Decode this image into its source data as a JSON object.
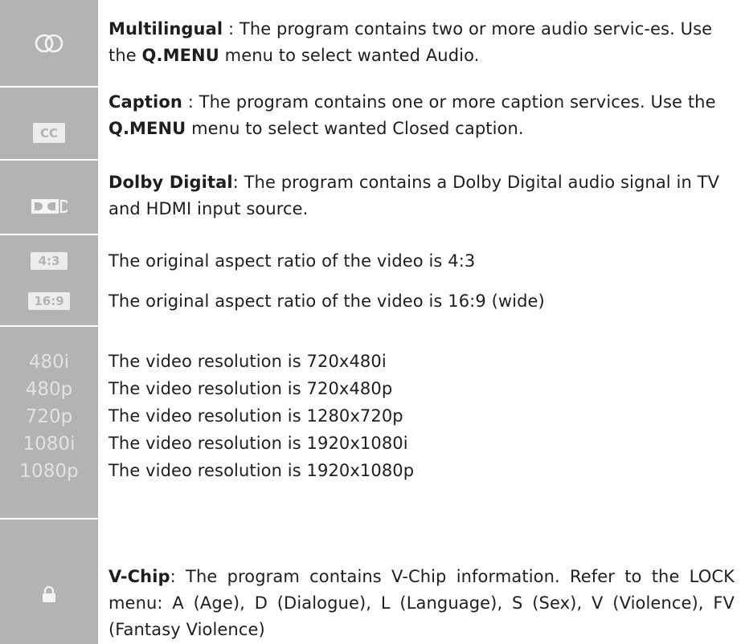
{
  "rows": {
    "multilingual": {
      "term": "Multilingual",
      "t1": " : The program contains two or more audio servic-es. Use the ",
      "menu": "Q.MENU",
      "t2": " menu to select wanted Audio."
    },
    "caption": {
      "icon_text": "CC",
      "term": "Caption",
      "t1": " : The program contains one or more caption services. Use the ",
      "menu": "Q.MENU",
      "t2": " menu to select wanted Closed caption."
    },
    "dolby": {
      "term": "Dolby Digital",
      "t1": ": The program contains a Dolby Digital audio signal in TV and HDMI input source."
    },
    "aspect": [
      {
        "badge": "4:3",
        "text": "The original aspect ratio of the video is 4:3"
      },
      {
        "badge": "16:9",
        "text": "The original aspect ratio of the video is 16:9 (wide)"
      }
    ],
    "resolutions": [
      {
        "label": "480i",
        "text": "The video resolution is 720x480i"
      },
      {
        "label": "480p",
        "text": "The video resolution is 720x480p"
      },
      {
        "label": "720p",
        "text": "The video resolution is 1280x720p"
      },
      {
        "label": "1080i",
        "text": "The video resolution is 1920x1080i"
      },
      {
        "label": "1080p",
        "text": "The video resolution is 1920x1080p"
      }
    ],
    "vchip": {
      "term": "V-Chip",
      "t1": ": The program contains V-Chip information. Refer to the LOCK menu: A (Age), D (Dialogue), L (Language), S (Sex), V (Violence), FV (Fantasy Violence)"
    }
  },
  "icons": {
    "multilingual": "multilingual-icon",
    "caption": "caption-cc-icon",
    "dolby": "dolby-digital-icon",
    "lock": "lock-icon"
  },
  "colors": {
    "rail": "#b3b3b3",
    "badge_fill": "#ececec",
    "text": "#1e1e1e"
  }
}
